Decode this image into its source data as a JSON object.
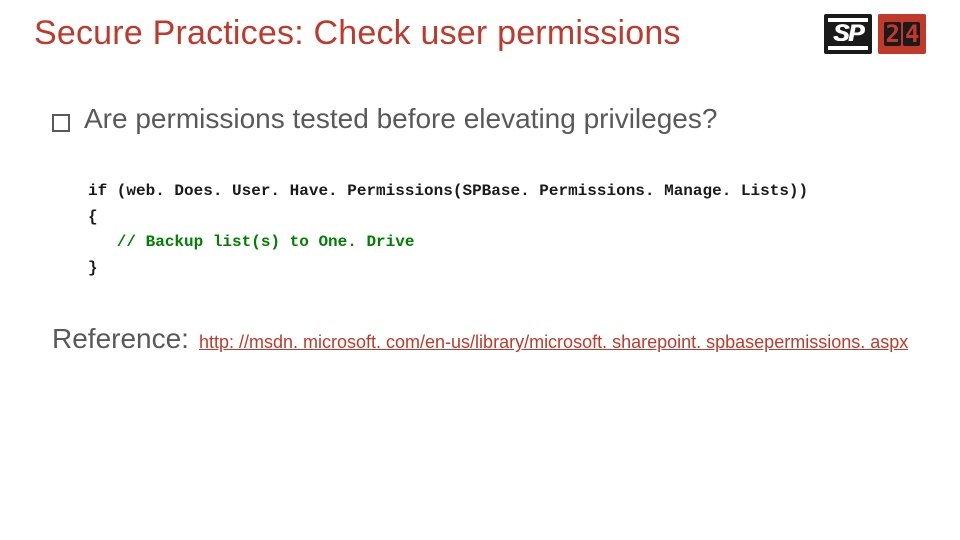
{
  "title": "Secure Practices: Check user permissions",
  "logo": {
    "sp": "SP",
    "d1": "2",
    "d2": "4"
  },
  "bullet": "Are permissions tested before elevating privileges?",
  "code": {
    "l1a": "if",
    "l1b": " (web. Does. User. Have. Permissions(SPBase. Permissions. Manage. Lists))",
    "l2": "{",
    "l3": "   // Backup list(s) to One. Drive",
    "l4": "}"
  },
  "reference": {
    "label": "Reference:",
    "url": "http: //msdn. microsoft. com/en-us/library/microsoft. sharepoint. spbasepermissions. aspx"
  }
}
